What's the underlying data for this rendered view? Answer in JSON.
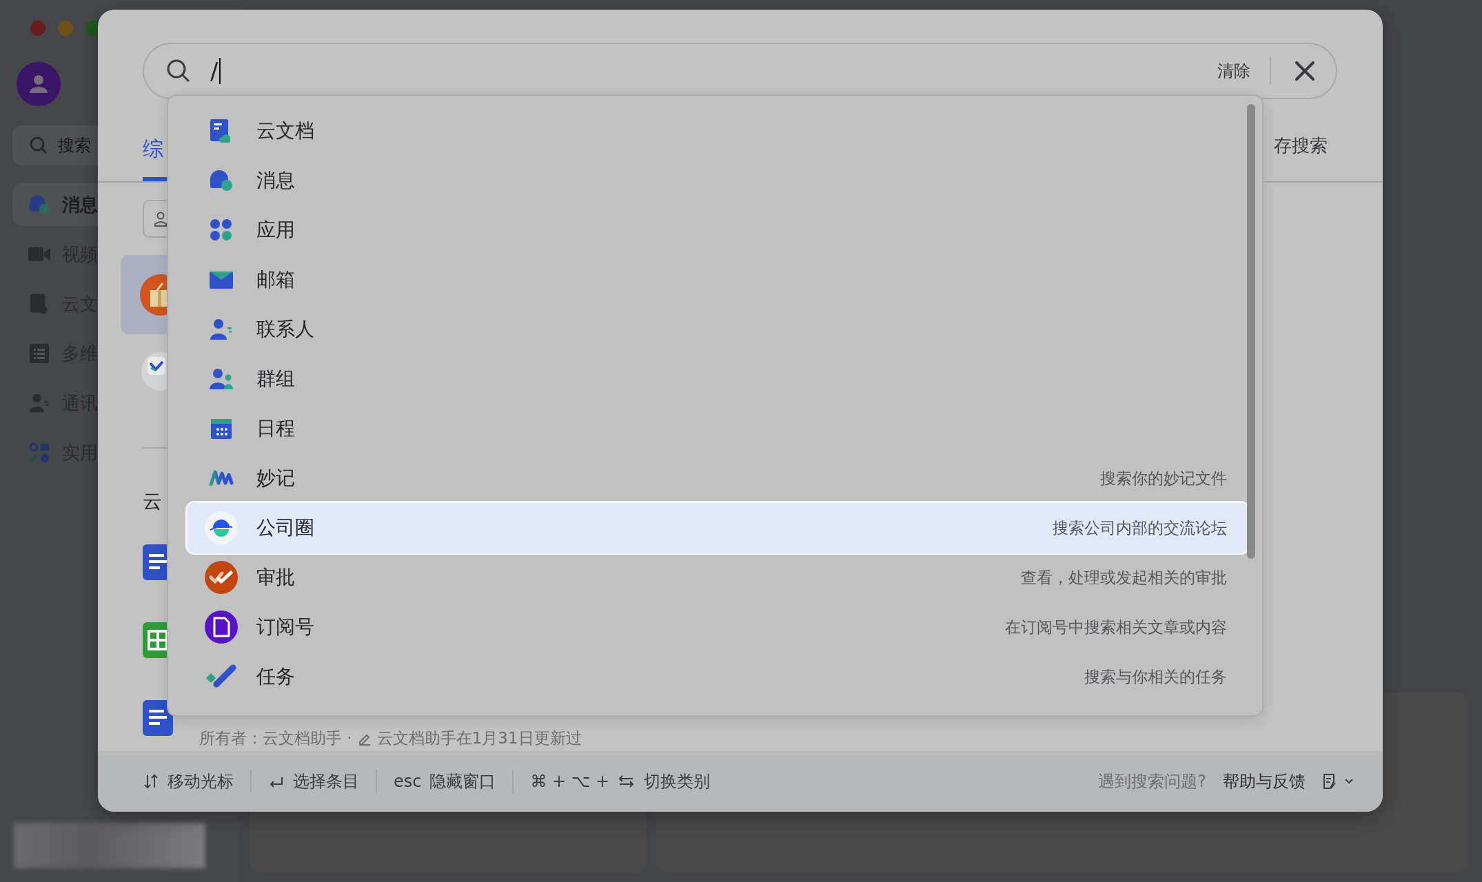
{
  "sidebar": {
    "search": {
      "placeholder": "搜索"
    },
    "items": [
      {
        "kind": "messages",
        "label": "消息",
        "selected": true
      },
      {
        "kind": "video",
        "label": "视频",
        "selected": false
      },
      {
        "kind": "docs",
        "label": "云文",
        "selected": false
      },
      {
        "kind": "base",
        "label": "多维",
        "selected": false
      },
      {
        "kind": "contacts",
        "label": "通讯",
        "selected": false
      },
      {
        "kind": "tools",
        "label": "实用",
        "selected": false
      }
    ]
  },
  "search": {
    "value": "/",
    "clear_label": "清除"
  },
  "tabs": [
    {
      "label": "综",
      "selected": true
    }
  ],
  "save_search": "存搜索",
  "results": {
    "heading": "云",
    "owner_meta": "所有者：云文档助手 ·",
    "update_meta": "云文档助手在1月31日更新过"
  },
  "dropdown": {
    "items": [
      {
        "kind": "docs",
        "label": "云文档",
        "selected": false
      },
      {
        "kind": "messages",
        "label": "消息",
        "selected": false
      },
      {
        "kind": "apps",
        "label": "应用",
        "selected": false
      },
      {
        "kind": "mail",
        "label": "邮箱",
        "selected": false
      },
      {
        "kind": "contacts",
        "label": "联系人",
        "selected": false
      },
      {
        "kind": "groups",
        "label": "群组",
        "selected": false
      },
      {
        "kind": "calendar",
        "label": "日程",
        "selected": false
      },
      {
        "kind": "minutes",
        "label": "妙记",
        "description": "搜索你的妙记文件",
        "selected": false
      },
      {
        "kind": "moments",
        "label": "公司圈",
        "description": "搜索公司内部的交流论坛",
        "selected": true
      },
      {
        "kind": "approval",
        "label": "审批",
        "description": "查看，处理或发起相关的审批",
        "selected": false
      },
      {
        "kind": "subscription",
        "label": "订阅号",
        "description": "在订阅号中搜索相关文章或内容",
        "selected": false
      },
      {
        "kind": "tasks",
        "label": "任务",
        "description": "搜索与你相关的任务",
        "selected": false
      }
    ]
  },
  "footer": {
    "hints": [
      {
        "kind": "move",
        "label": "移动光标"
      },
      {
        "kind": "select",
        "label": "选择条目"
      },
      {
        "kind": "hide",
        "key": "esc",
        "label": "隐藏窗口"
      },
      {
        "kind": "switch",
        "key": "⌘ + ⌥ +",
        "label": "切换类别"
      }
    ],
    "help_question": "遇到搜索问题?",
    "help_link": "帮助与反馈"
  }
}
